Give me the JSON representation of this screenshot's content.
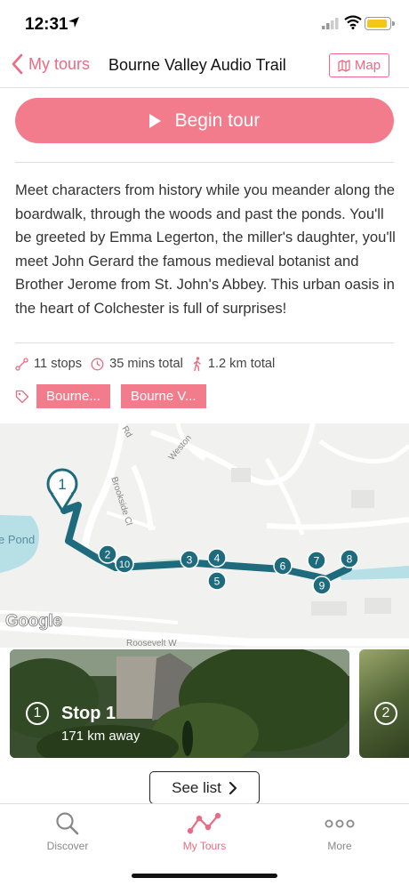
{
  "status_bar": {
    "time": "12:31"
  },
  "nav": {
    "back_label": "My tours",
    "title": "Bourne Valley Audio Trail",
    "map_label": "Map"
  },
  "begin_button": "Begin tour",
  "description": "Meet characters from history while you meander along the boardwalk, through the woods and past the ponds. You'll be greeted by Emma Legerton, the miller's daughter, you'll meet John Gerard the famous medieval botanist and Brother Jerome from St. John's Abbey. This urban oasis in the heart of Colchester is full of surprises!",
  "meta": {
    "stops": "11 stops",
    "duration": "35 mins total",
    "distance": "1.2 km total"
  },
  "tags": [
    "Bourne...",
    "Bourne V..."
  ],
  "map": {
    "pond_label": "e Pond",
    "google_label": "Google",
    "roads": [
      "Weston",
      "Rd",
      "Brookside Cl",
      "Roosevelt W"
    ],
    "markers": [
      "1",
      "2",
      "10",
      "3",
      "4",
      "5",
      "6",
      "7",
      "9",
      "8"
    ]
  },
  "cards": [
    {
      "number": "1",
      "title": "Stop 1",
      "subtitle": "171 km away"
    },
    {
      "number": "2"
    }
  ],
  "see_list": "See list",
  "tabs": [
    {
      "label": "Discover"
    },
    {
      "label": "My Tours"
    },
    {
      "label": "More"
    }
  ],
  "colors": {
    "accent": "#f27c8c",
    "route": "#1f6b7e",
    "water": "#b6dfe6"
  }
}
